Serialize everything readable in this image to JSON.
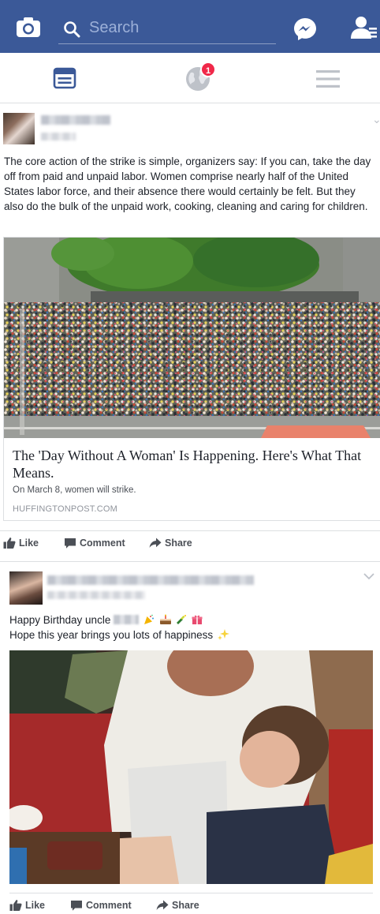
{
  "topbar": {
    "search_placeholder": "Search",
    "brand_color": "#3b5998",
    "icons": [
      "camera-icon",
      "search-icon",
      "messenger-icon",
      "friend-requests-icon"
    ]
  },
  "nav": {
    "icons": [
      "news-feed-icon",
      "notifications-globe-icon",
      "menu-icon"
    ],
    "notification_count": "1",
    "badge_color": "#f02849"
  },
  "post1": {
    "body": "The core action of the strike is simple, organizers say: If you can, take the day off from paid and unpaid labor. Women comprise nearly half of the United States labor force, and their absence there would certainly be felt. But they also do the bulk of the unpaid work, cooking, cleaning and caring for children.",
    "link": {
      "title": "The 'Day Without A Woman' Is Happening. Here's What That Means.",
      "description": "On March 8, women will strike.",
      "source": "HUFFINGTONPOST.COM"
    },
    "actions": {
      "like": "Like",
      "comment": "Comment",
      "share": "Share"
    }
  },
  "post2": {
    "line1_prefix": "Happy Birthday uncle",
    "line2": "Hope this year brings you lots of happiness",
    "actions": {
      "like": "Like",
      "comment": "Comment",
      "share": "Share"
    }
  }
}
